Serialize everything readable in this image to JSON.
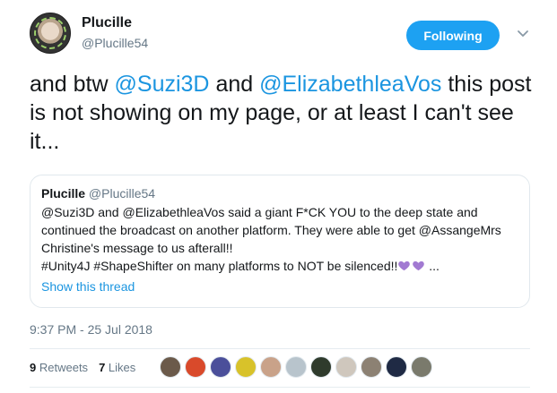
{
  "user": {
    "name": "Plucille",
    "handle": "@Plucille54",
    "follow_label": "Following"
  },
  "tweet": {
    "text_before": "and btw ",
    "mention_1": "@Suzi3D",
    "text_middle": " and ",
    "mention_2": "@ElizabethleaVos",
    "text_after": " this post is not showing on my page, or at least I can't see it..."
  },
  "quoted": {
    "name": "Plucille",
    "handle": "@Plucille54",
    "line_1": "@Suzi3D and @ElizabethleaVos said a giant F*CK YOU to the deep state and",
    "line_2": "continued the broadcast on another platform.  They were able to get @AssangeMrs",
    "line_3": "Christine's message to us afterall!!",
    "line_4_text": "#Unity4J  #ShapeShifter on many platforms to NOT be silenced!!",
    "line_4_suffix": " ...",
    "show_thread": "Show this thread"
  },
  "timestamp": "9:37 PM - 25 Jul 2018",
  "stats": {
    "retweets_count": "9",
    "retweets_label": "Retweets",
    "likes_count": "7",
    "likes_label": "Likes"
  },
  "colors": {
    "accent": "#1da1f2",
    "link": "#1b95e0",
    "muted": "#657786",
    "heart": "#a27ad2"
  },
  "likers": [
    {
      "name": "liker-avatar-1",
      "color": "#6b5a4a"
    },
    {
      "name": "liker-avatar-2",
      "color": "#d94a2b"
    },
    {
      "name": "liker-avatar-3",
      "color": "#4b4f9a"
    },
    {
      "name": "liker-avatar-4",
      "color": "#d8c22a"
    },
    {
      "name": "liker-avatar-5",
      "color": "#c9a289"
    },
    {
      "name": "liker-avatar-6",
      "color": "#b8c4cc"
    },
    {
      "name": "liker-avatar-7",
      "color": "#2f3b2c"
    },
    {
      "name": "liker-avatar-8",
      "color": "#cfc7bd"
    },
    {
      "name": "liker-avatar-9",
      "color": "#8c8173"
    },
    {
      "name": "liker-avatar-10",
      "color": "#1f2a44"
    },
    {
      "name": "liker-avatar-11",
      "color": "#7a7a6c"
    }
  ]
}
